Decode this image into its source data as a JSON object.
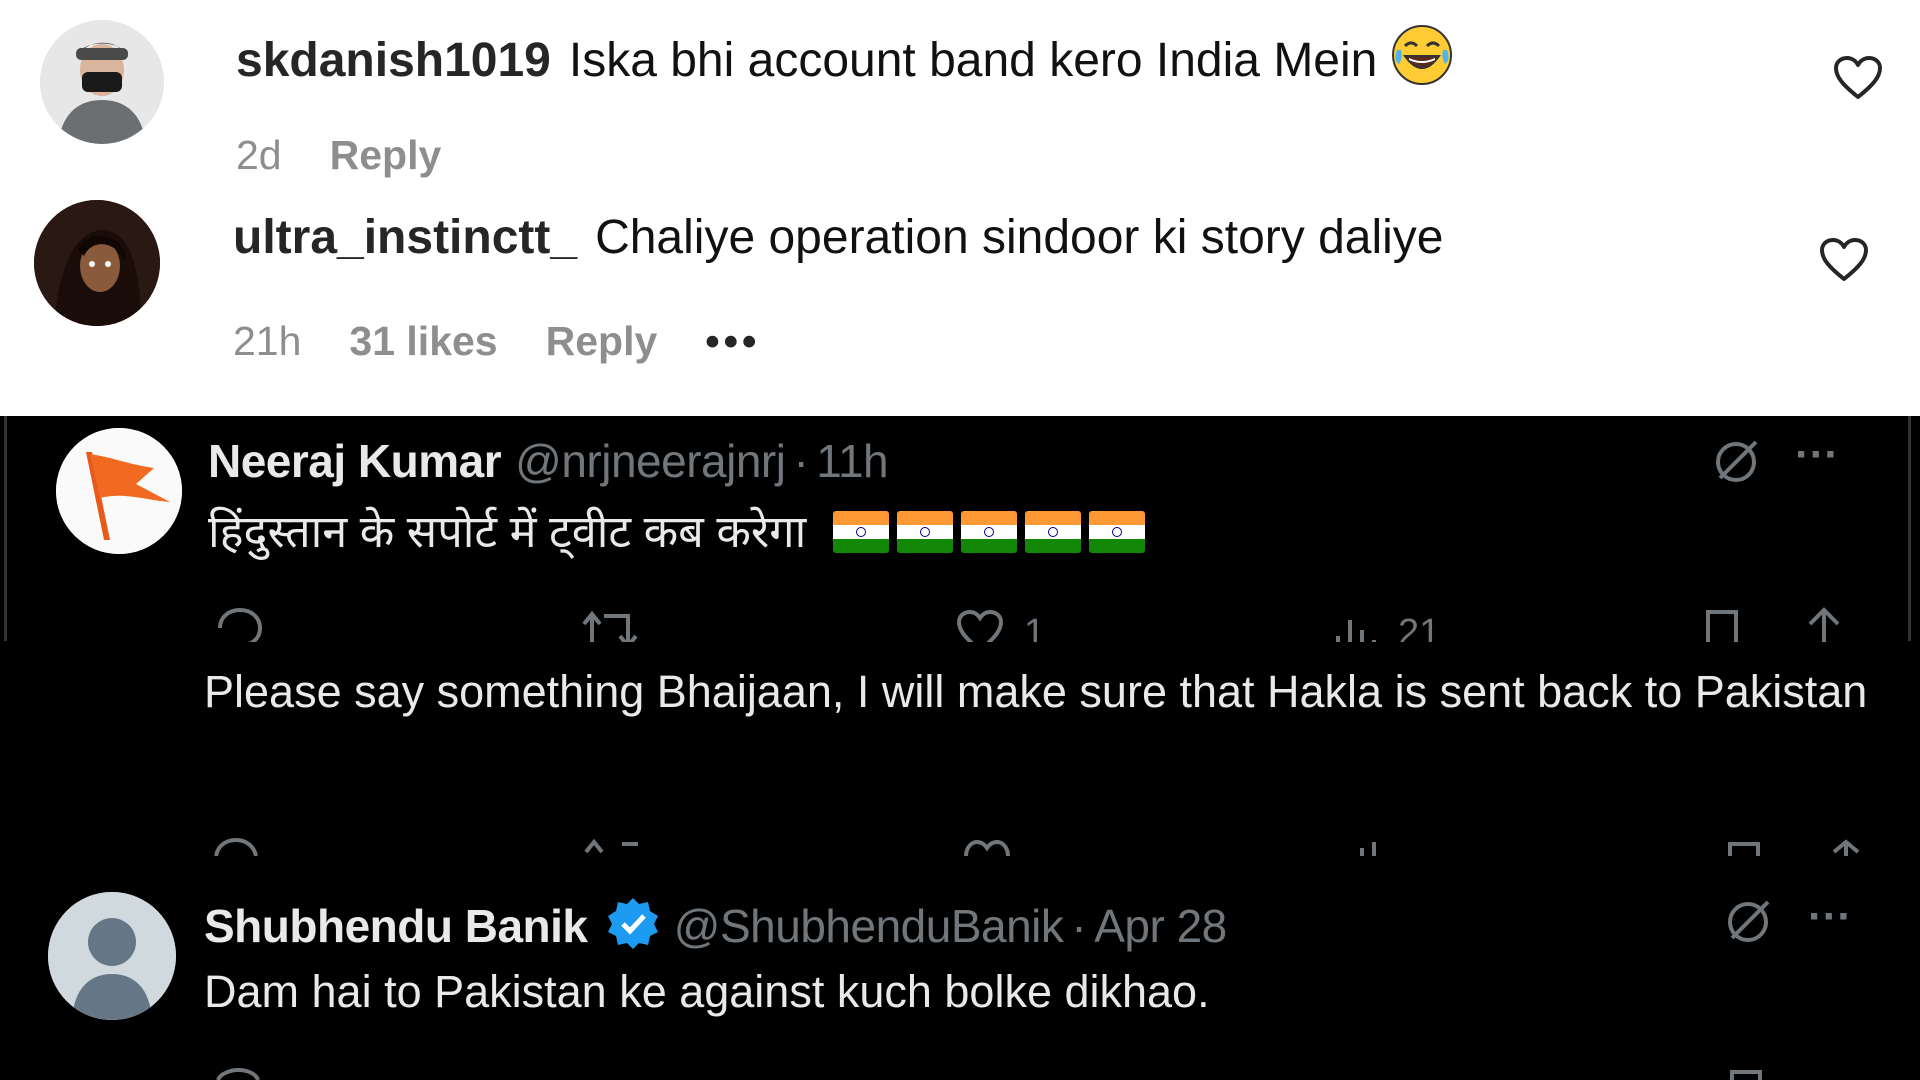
{
  "instagram": {
    "comments": [
      {
        "username": "skdanish1019",
        "text": "Iska bhi account band kero India Mein",
        "emoji_icon": "face-with-tears-of-joy-icon",
        "time": "2d",
        "likes": "",
        "reply_label": "Reply"
      },
      {
        "username": "ultra_instinctt_",
        "text": "Chaliye operation sindoor ki story daliye",
        "time": "21h",
        "likes": "31 likes",
        "reply_label": "Reply",
        "more_label": "•••"
      }
    ]
  },
  "x": {
    "posts": [
      {
        "name": "Neeraj Kumar",
        "handle": "@nrjneerajnrj",
        "dot": "·",
        "time": "11h",
        "text": "हिंदुस्तान के सपोर्ट में ट्वीट कब करेगा",
        "flags": 5,
        "likes": "1",
        "views": "21",
        "more_label": "···"
      },
      {
        "text": "Please say something Bhaijaan, I will make sure that Hakla is sent back to Pakistan"
      },
      {
        "name": "Shubhendu Banik",
        "handle": "@ShubhenduBanik",
        "dot": "·",
        "time": "Apr 28",
        "verified": true,
        "text": "Dam hai to Pakistan ke against kuch bolke dikhao.",
        "more_label": "···"
      }
    ]
  },
  "colors": {
    "x_background": "#000000",
    "x_text": "#e7e9ea",
    "x_muted": "#71767b",
    "verified_blue": "#1d9bf0",
    "ig_muted": "#8e8e8e"
  }
}
